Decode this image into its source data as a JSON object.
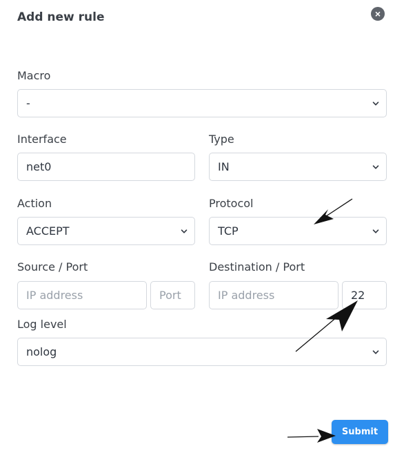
{
  "dialog": {
    "title": "Add new rule",
    "close_icon": "close-icon"
  },
  "form": {
    "macro": {
      "label": "Macro",
      "value": "-"
    },
    "interface": {
      "label": "Interface",
      "value": "net0"
    },
    "type": {
      "label": "Type",
      "value": "IN"
    },
    "action": {
      "label": "Action",
      "value": "ACCEPT"
    },
    "protocol": {
      "label": "Protocol",
      "value": "TCP"
    },
    "source": {
      "label": "Source / Port",
      "ip_placeholder": "IP address",
      "port_placeholder": "Port"
    },
    "destination": {
      "label": "Destination / Port",
      "ip_placeholder": "IP address",
      "port_value": "22"
    },
    "log_level": {
      "label": "Log level",
      "value": "nolog"
    }
  },
  "footer": {
    "submit_label": "Submit"
  }
}
